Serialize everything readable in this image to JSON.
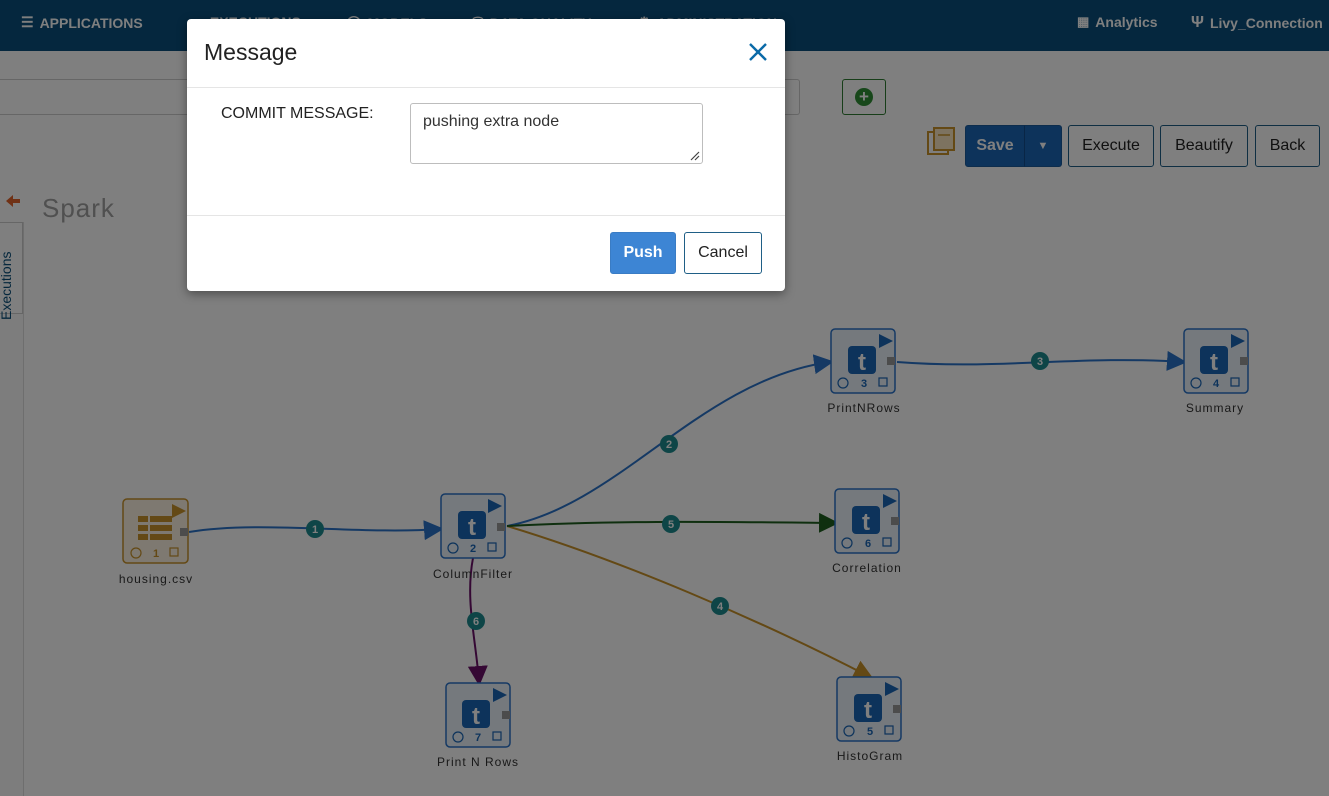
{
  "nav": {
    "applications": "APPLICATIONS",
    "executions": "EXECUTIONS",
    "models": "MODELS",
    "data_quality": "DATA QUALITY",
    "administration": "ADMINISTRATION",
    "analytics": "Analytics",
    "connection": "Livy_Connection"
  },
  "toolbar": {
    "save": "Save",
    "execute": "Execute",
    "beautify": "Beautify",
    "back": "Back"
  },
  "side_tab": "Executions",
  "canvas_title": "Spark",
  "nodes": [
    {
      "id": "1",
      "label": "housing.csv",
      "kind": "dataset"
    },
    {
      "id": "2",
      "label": "ColumnFilter",
      "kind": "transform"
    },
    {
      "id": "3",
      "label": "PrintNRows",
      "kind": "transform"
    },
    {
      "id": "4",
      "label": "Summary",
      "kind": "transform"
    },
    {
      "id": "5",
      "label": "HistoGram",
      "kind": "transform"
    },
    {
      "id": "6",
      "label": "Correlation",
      "kind": "transform"
    },
    {
      "id": "7",
      "label": "Print N Rows",
      "kind": "transform"
    }
  ],
  "edges": [
    {
      "label": "1",
      "from": "1",
      "to": "2",
      "color": "#2a73c9"
    },
    {
      "label": "2",
      "from": "2",
      "to": "3",
      "color": "#2a73c9"
    },
    {
      "label": "3",
      "from": "3",
      "to": "4",
      "color": "#2a73c9"
    },
    {
      "label": "4",
      "from": "2",
      "to": "5",
      "color": "#c8922a"
    },
    {
      "label": "5",
      "from": "2",
      "to": "6",
      "color": "#1e5f1e"
    },
    {
      "label": "6",
      "from": "2",
      "to": "7",
      "color": "#6b1068"
    }
  ],
  "modal": {
    "title": "Message",
    "commit_label": "COMMIT MESSAGE:",
    "commit_value": "pushing extra node",
    "push": "Push",
    "cancel": "Cancel"
  }
}
